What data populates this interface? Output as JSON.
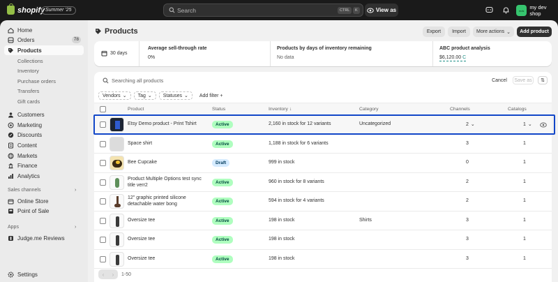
{
  "topbar": {
    "brand": "shopify",
    "edition": "Summer '25",
    "search_placeholder": "Search",
    "shortcut_ctrl": "CTRL",
    "shortcut_key": "K",
    "view_as": "View as",
    "shop_avatar": "mds",
    "shop_name": "my dev shop"
  },
  "sidebar": {
    "home": "Home",
    "orders": "Orders",
    "orders_count": "78",
    "products": "Products",
    "collections": "Collections",
    "inventory": "Inventory",
    "purchase_orders": "Purchase orders",
    "transfers": "Transfers",
    "gift_cards": "Gift cards",
    "customers": "Customers",
    "marketing": "Marketing",
    "discounts": "Discounts",
    "content": "Content",
    "markets": "Markets",
    "finance": "Finance",
    "analytics": "Analytics",
    "sales_channels": "Sales channels",
    "online_store": "Online Store",
    "point_of_sale": "Point of Sale",
    "apps": "Apps",
    "judge_me": "Judge.me Reviews",
    "settings": "Settings"
  },
  "page": {
    "title": "Products",
    "export": "Export",
    "import": "Import",
    "more_actions": "More actions",
    "add_product": "Add product"
  },
  "stats": {
    "days": "30 days",
    "sell_through_label": "Average sell-through rate",
    "sell_through_value": "0%",
    "doi_label": "Products by days of inventory remaining",
    "doi_value": "No data",
    "abc_label": "ABC product analysis",
    "abc_value": "$6,120.00",
    "abc_grade": "C"
  },
  "table": {
    "search_placeholder": "Searching all products",
    "cancel": "Cancel",
    "save_as": "Save as",
    "filters": [
      "Vendors",
      "Tag",
      "Statuses"
    ],
    "add_filter": "Add filter +",
    "headers": {
      "product": "Product",
      "status": "Status",
      "inventory": "Inventory ↓",
      "category": "Category",
      "channels": "Channels",
      "catalogs": "Catalogs"
    },
    "rows": [
      {
        "name": "Etsy Demo product - Print Tshirt",
        "status": "Active",
        "inventory": "2,160 in stock for 12 variants",
        "category": "Uncategorized",
        "channels": "2",
        "catalogs": "1"
      },
      {
        "name": "Space shirt",
        "status": "Active",
        "inventory": "1,188 in stock for 6 variants",
        "category": "",
        "channels": "3",
        "catalogs": "1"
      },
      {
        "name": "Bee Cupcake",
        "status": "Draft",
        "inventory": "999 in stock",
        "category": "",
        "channels": "0",
        "catalogs": "1"
      },
      {
        "name": "Product Multiple Options test sync title verr2",
        "status": "Active",
        "inventory": "960 in stock for 8 variants",
        "category": "",
        "channels": "2",
        "catalogs": "1"
      },
      {
        "name": "12\" graphic printed silicone detachable water bong",
        "status": "Active",
        "inventory": "594 in stock for 4 variants",
        "category": "",
        "channels": "2",
        "catalogs": "1"
      },
      {
        "name": "Oversize tee",
        "status": "Active",
        "inventory": "198 in stock",
        "category": "Shirts",
        "channels": "3",
        "catalogs": "1"
      },
      {
        "name": "Oversize tee",
        "status": "Active",
        "inventory": "198 in stock",
        "category": "",
        "channels": "3",
        "catalogs": "1"
      },
      {
        "name": "Oversize tee",
        "status": "Active",
        "inventory": "198 in stock",
        "category": "",
        "channels": "3",
        "catalogs": "1"
      }
    ],
    "pagination": "1-50"
  },
  "colors": {
    "highlight": "#1146c8",
    "active_badge": "#affebf",
    "draft_badge": "#d5ebff",
    "shop_avatar": "#36c46e"
  }
}
